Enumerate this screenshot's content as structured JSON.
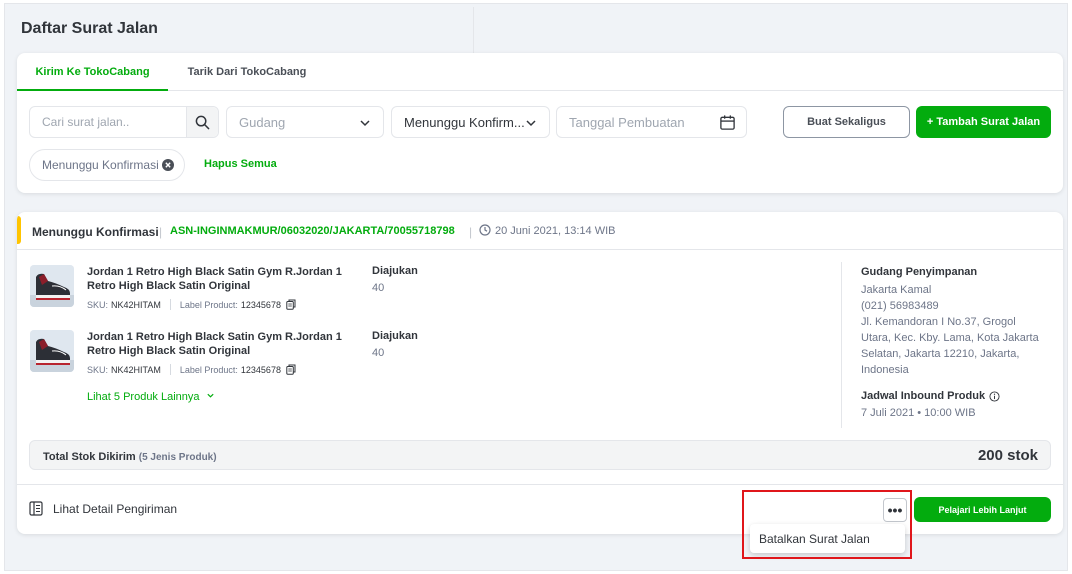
{
  "page": {
    "title": "Daftar Surat Jalan"
  },
  "tabs": [
    {
      "label": "Kirim Ke TokoCabang"
    },
    {
      "label": "Tarik Dari TokoCabang"
    }
  ],
  "filters": {
    "search_placeholder": "Cari surat jalan..",
    "gudang_placeholder": "Gudang",
    "status_value": "Menunggu Konfirm...",
    "tanggal_placeholder": "Tanggal Pembuatan",
    "bulk_button": "Buat Sekaligus",
    "add_button": "+ Tambah Surat Jalan",
    "active_chip": "Menunggu Konfirmasi",
    "clear_all": "Hapus Semua"
  },
  "shipment": {
    "status": "Menunggu Konfirmasi",
    "code": "ASN-INGINMAKMUR/06032020/JAKARTA/70055718798",
    "date": "20 Juni 2021, 13:14 WIB",
    "products": [
      {
        "name": "Jordan 1 Retro High Black Satin Gym R.Jordan 1 Retro High Black Satin Original",
        "sku_label": "SKU:",
        "sku": "NK42HITAM",
        "product_label_label": "Label Product:",
        "product_label": "12345678",
        "qty_label": "Diajukan",
        "qty": "40"
      },
      {
        "name": "Jordan 1 Retro High Black Satin Gym R.Jordan 1 Retro High Black Satin Original",
        "sku_label": "SKU:",
        "sku": "NK42HITAM",
        "product_label_label": "Label Product:",
        "product_label": "12345678",
        "qty_label": "Diajukan",
        "qty": "40"
      }
    ],
    "more_products": "Lihat 5 Produk Lainnya",
    "warehouse": {
      "title": "Gudang Penyimpanan",
      "name": "Jakarta Kamal",
      "phone": "(021) 56983489",
      "address_lines": [
        "Jl. Kemandoran I No.37, Grogol",
        "Utara, Kec. Kby. Lama, Kota Jakarta",
        "Selatan, Jakarta 12210, Jakarta,",
        "Indonesia"
      ]
    },
    "schedule": {
      "title": "Jadwal Inbound Produk",
      "value": "7 Juli 2021 • 10:00 WIB"
    },
    "total": {
      "label": "Total Stok Dikirim",
      "detail": "(5 Jenis Produk)",
      "value": "200 stok"
    },
    "footer": {
      "detail_link": "Lihat Detail Pengiriman",
      "more_button": "•••",
      "learn_button": "Pelajari Lebih Lanjut"
    },
    "dropdown_menu": {
      "items": [
        "Batalkan Surat Jalan"
      ]
    }
  },
  "colors": {
    "accent": "#03ac0e",
    "status_bar": "#ffc400",
    "highlight_box": "#e0161b"
  }
}
